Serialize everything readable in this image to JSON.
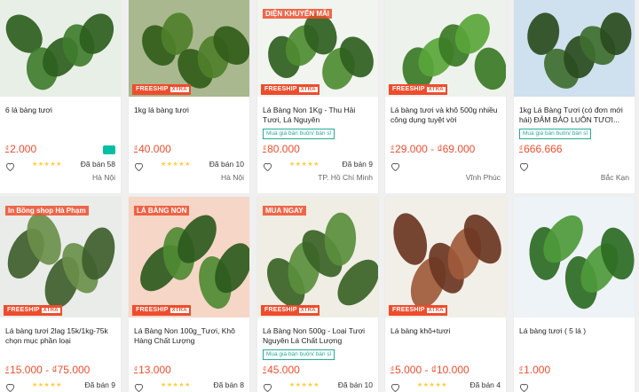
{
  "products": [
    {
      "title": "6 lá bàng tươi",
      "price": "2.000",
      "sold": "Đã bán 58",
      "location": "Hà Nội",
      "freeship": false
    },
    {
      "title": "1kg lá bàng tươi",
      "price": "40.000",
      "sold": "Đã bán 10",
      "location": "Hà Nội",
      "freeship": true
    },
    {
      "title": "Lá Bàng Non 1Kg - Thu Hải Tươi, Lá Nguyên",
      "price": "80.000",
      "sold": "Đã bán 9",
      "location": "TP. Hồ Chí Minh",
      "freeship": true,
      "wholesale": "Mua giá bán buôn/ bán sỉ",
      "overlay": "DIỆN KHUYẾN MÃI"
    },
    {
      "title": "Lá bàng tươi và khô 500g nhiều công dụng tuyệt vời",
      "price": "29.000 - ₫69.000",
      "sold": "",
      "location": "Vĩnh Phúc",
      "freeship": true
    },
    {
      "title": "1kg Lá Bàng Tươi (có đơn mới hái) ĐẢM BẢO LUÔN TƯƠI...",
      "price": "666.666",
      "sold": "",
      "location": "Bắc Kạn",
      "freeship": false,
      "wholesale": "Mua giá bán buôn/ bán sỉ"
    },
    {
      "title": "Lá bàng tươi 2lag 15k/1kg-75k chọn mục phần loại",
      "price": "15.000 - ₫75.000",
      "sold": "Đã bán 9",
      "location": "",
      "freeship": true,
      "overlay": "In Bồng shop Hà Phạm"
    },
    {
      "title": "Lá Bàng Non 100g_Tươi, Khô Hàng Chất Lượng",
      "price": "13.000",
      "sold": "Đã bán 8",
      "location": "",
      "freeship": true,
      "overlay": "LÁ BÀNG NON"
    },
    {
      "title": "Lá Bàng Non 500g - Loại Tươi Nguyên Lá Chất Lượng",
      "price": "45.000",
      "sold": "Đã bán 10",
      "location": "",
      "freeship": true,
      "wholesale": "Mua giá bán buôn/ bán sỉ",
      "overlay": "MUA NGAY"
    },
    {
      "title": "Lá bàng khô+tươi",
      "price": "5.000 - ₫10.000",
      "sold": "Đã bán 4",
      "location": "",
      "freeship": true
    },
    {
      "title": "Lá bàng tươi ( 5 lá )",
      "price": "1.000",
      "sold": "",
      "location": "",
      "freeship": false
    }
  ],
  "currency": "₫",
  "freeship_label": "FREESHIP",
  "freeship_tag": "XTRA"
}
